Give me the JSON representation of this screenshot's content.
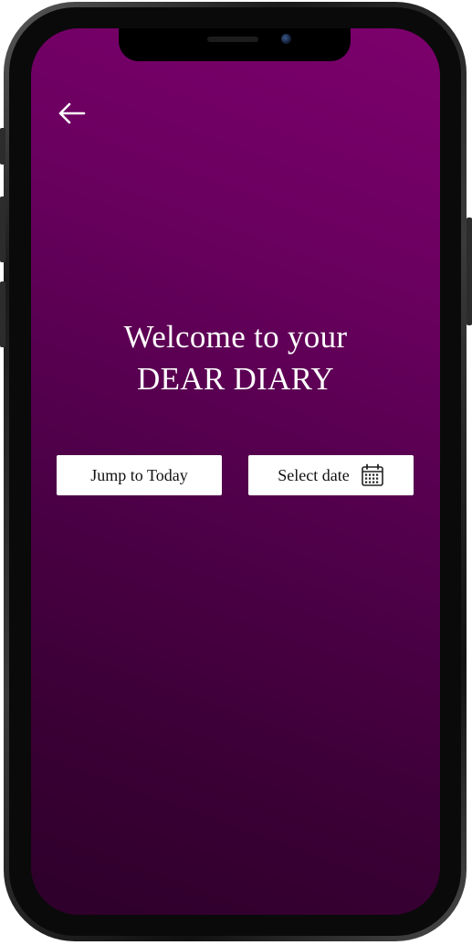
{
  "screen": {
    "welcome_line1": "Welcome to your",
    "welcome_line2": "DEAR DIARY"
  },
  "actions": {
    "jump_today_label": "Jump to Today",
    "select_date_label": "Select date"
  },
  "icons": {
    "back": "arrow-left-icon",
    "calendar": "calendar-icon"
  },
  "colors": {
    "background_top": "#7c006c",
    "background_bottom": "#2e002a",
    "button_bg": "#ffffff",
    "text_light": "#ffffff"
  }
}
